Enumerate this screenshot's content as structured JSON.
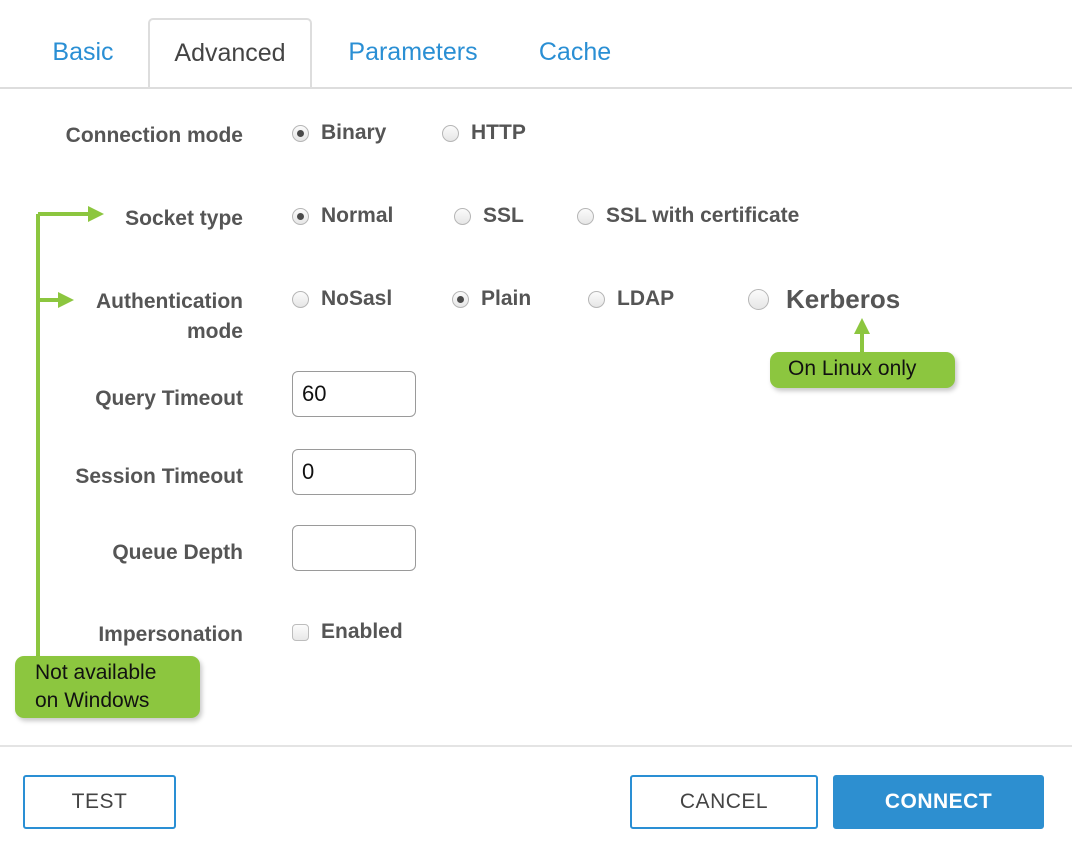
{
  "tabs": [
    {
      "label": "Basic",
      "active": false
    },
    {
      "label": "Advanced",
      "active": true
    },
    {
      "label": "Parameters",
      "active": false
    },
    {
      "label": "Cache",
      "active": false
    }
  ],
  "form": {
    "connection_mode": {
      "label": "Connection mode",
      "options": [
        {
          "label": "Binary",
          "selected": true
        },
        {
          "label": "HTTP",
          "selected": false
        }
      ]
    },
    "socket_type": {
      "label": "Socket type",
      "options": [
        {
          "label": "Normal",
          "selected": true
        },
        {
          "label": "SSL",
          "selected": false
        },
        {
          "label": "SSL with certificate",
          "selected": false
        }
      ]
    },
    "authentication_mode": {
      "label_line1": "Authentication",
      "label_line2": "mode",
      "options": [
        {
          "label": "NoSasl",
          "selected": false
        },
        {
          "label": "Plain",
          "selected": true
        },
        {
          "label": "LDAP",
          "selected": false
        },
        {
          "label": "Kerberos",
          "selected": false
        }
      ]
    },
    "query_timeout": {
      "label": "Query Timeout",
      "value": "60"
    },
    "session_timeout": {
      "label": "Session Timeout",
      "value": "0"
    },
    "queue_depth": {
      "label": "Queue Depth",
      "value": ""
    },
    "impersonation": {
      "label": "Impersonation",
      "checkbox_label": "Enabled",
      "checked": false
    }
  },
  "annotations": {
    "windows_note_line1": "Not available",
    "windows_note_line2": "on Windows",
    "linux_note": "On Linux only",
    "color": "#8cc63f"
  },
  "footer": {
    "test_label": "TEST",
    "cancel_label": "CANCEL",
    "connect_label": "CONNECT",
    "accent_color": "#2d8fd0"
  }
}
